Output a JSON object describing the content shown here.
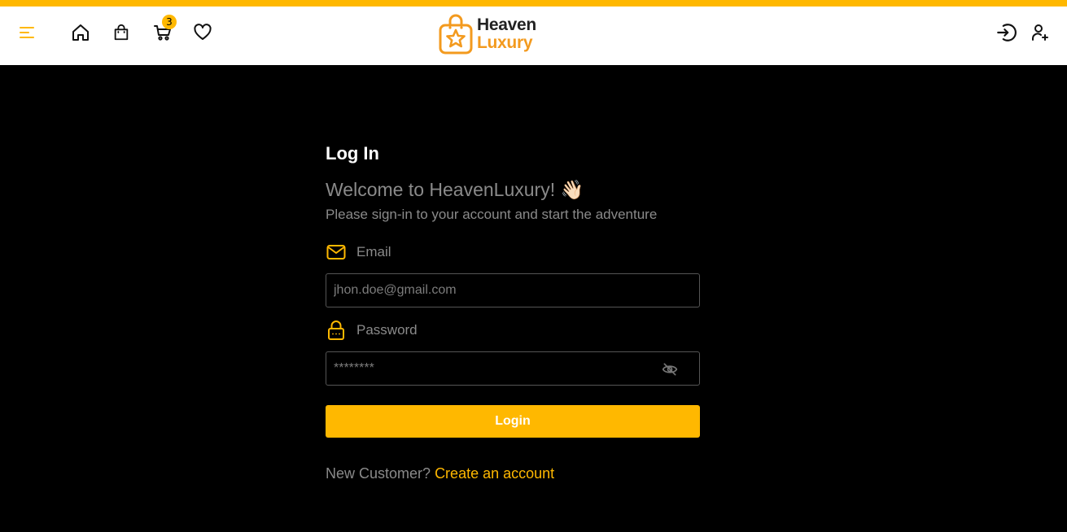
{
  "brand": {
    "line1": "Heaven",
    "line2": "Luxury",
    "accent": "#FFB800",
    "logo_orange": "#F39A1E"
  },
  "navbar": {
    "left_icons": [
      "menu-icon",
      "home-icon",
      "shopping-bag-icon",
      "cart-icon",
      "heart-icon"
    ],
    "cart_count": "3",
    "right_icons": [
      "login-icon",
      "user-plus-icon"
    ]
  },
  "login": {
    "title": "Log In",
    "welcome": "Welcome to HeavenLuxury! 👋🏻",
    "subtitle": "Please sign-in to your account and start the adventure",
    "email_label": "Email",
    "email_placeholder": "jhon.doe@gmail.com",
    "password_label": "Password",
    "password_placeholder": "********",
    "login_button": "Login",
    "new_customer_text": "New Customer?",
    "create_account_link": "Create an account"
  }
}
